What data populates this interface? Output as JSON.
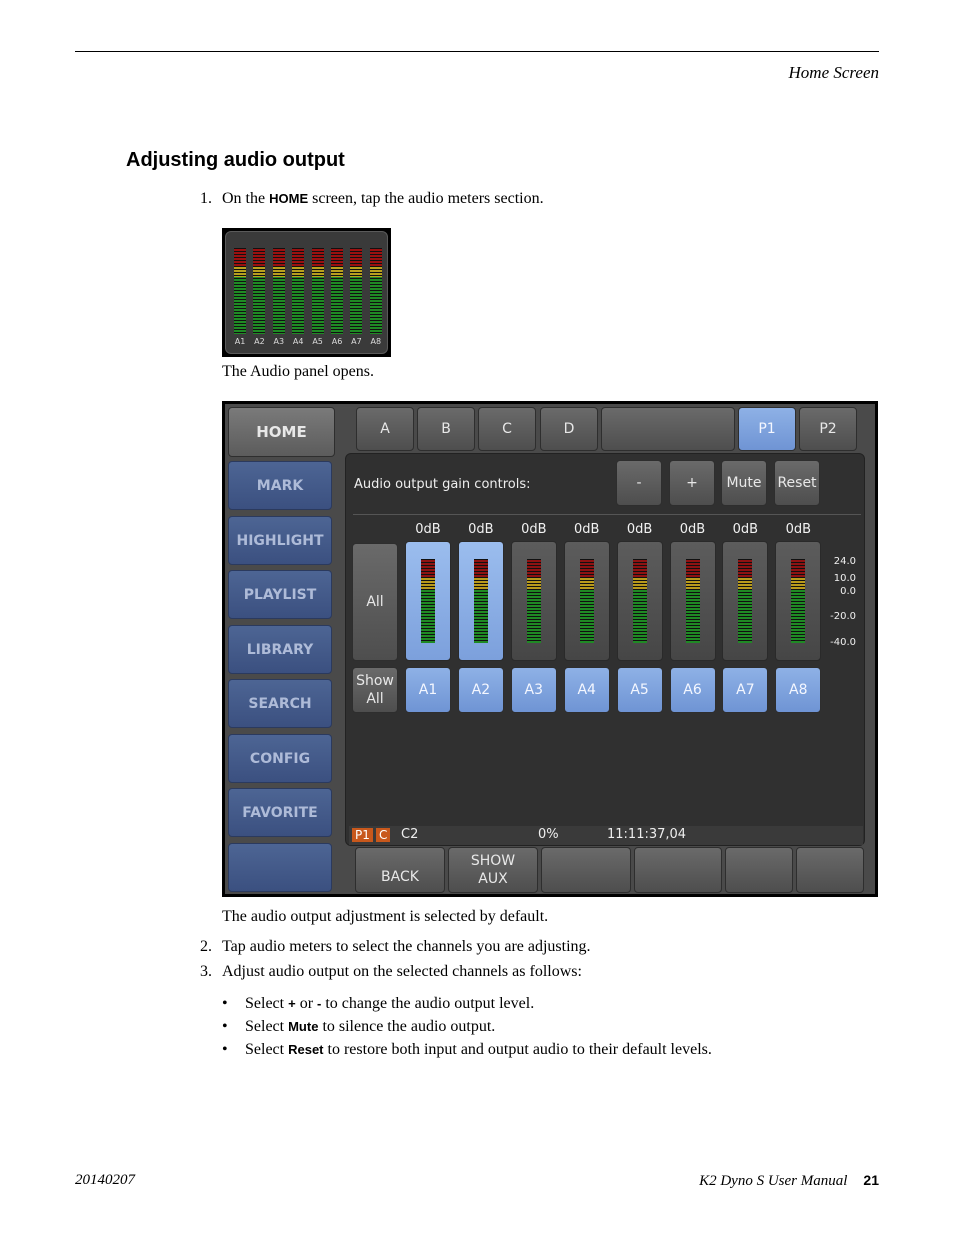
{
  "header": {
    "running_head": "Home Screen"
  },
  "section_title": "Adjusting audio output",
  "steps": {
    "s1": {
      "num": "1.",
      "pre": "On the ",
      "kw": "HOME",
      "post": " screen, tap the audio meters section."
    },
    "s2": {
      "num": "2.",
      "text": "Tap audio meters to select the channels you are adjusting."
    },
    "s3": {
      "num": "3.",
      "text": "Adjust audio output on the selected channels as follows:"
    }
  },
  "captions": {
    "panel_opens": "The Audio panel opens.",
    "default": "The audio output adjustment is selected by default."
  },
  "bullets": {
    "b1": {
      "pre": "Select ",
      "kw1": "+",
      "mid": " or ",
      "kw2": "-",
      "post": " to change the audio output level."
    },
    "b2": {
      "pre": "Select ",
      "kw": "Mute",
      "post": " to silence the audio output."
    },
    "b3": {
      "pre": "Select ",
      "kw": "Reset",
      "post": " to restore both input and output audio to their default levels."
    }
  },
  "thumbnail": {
    "labels": [
      "A1",
      "A2",
      "A3",
      "A4",
      "A5",
      "A6",
      "A7",
      "A8"
    ]
  },
  "panel": {
    "home": "HOME",
    "tabs": [
      "A",
      "B",
      "C",
      "D",
      "P1",
      "P2"
    ],
    "sidebar": [
      "MARK",
      "HIGHLIGHT",
      "PLAYLIST",
      "LIBRARY",
      "SEARCH",
      "CONFIG",
      "FAVORITE",
      ""
    ],
    "gain_label": "Audio output gain controls:",
    "gain_buttons": {
      "minus": "-",
      "plus": "+",
      "mute": "Mute",
      "reset": "Reset"
    },
    "all": "All",
    "show_all_1": "Show",
    "show_all_2": "All",
    "db_values": [
      "0dB",
      "0dB",
      "0dB",
      "0dB",
      "0dB",
      "0dB",
      "0dB",
      "0dB"
    ],
    "channels": [
      "A1",
      "A2",
      "A3",
      "A4",
      "A5",
      "A6",
      "A7",
      "A8"
    ],
    "selected_channels": [
      "A1",
      "A2"
    ],
    "scale": [
      "24.0",
      "10.0",
      "0.0",
      "-20.0",
      "-40.0"
    ],
    "status": {
      "p1": "P1",
      "c": "C",
      "c2": "C2",
      "percent": "0%",
      "timecode": "11:11:37,04"
    },
    "bottom": {
      "back": "BACK",
      "show_aux_1": "SHOW",
      "show_aux_2": "AUX"
    }
  },
  "footer": {
    "date": "20140207",
    "manual": "K2 Dyno S   User Manual",
    "page": "21"
  }
}
